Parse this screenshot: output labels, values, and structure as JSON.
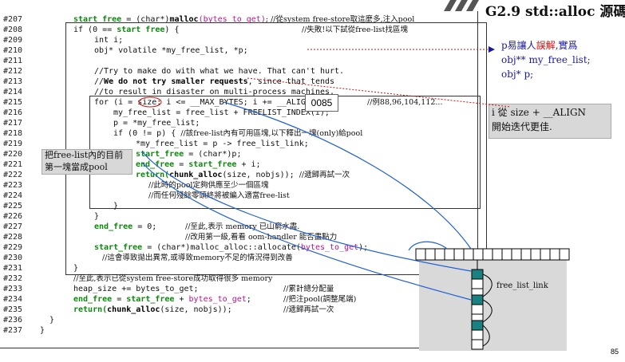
{
  "title": "G2.9 std::alloc 源碼剖",
  "tooltip_value": "0085",
  "page_number": "85",
  "line_numbers": [
    "#207",
    "#208",
    "#209",
    "#210",
    "#211",
    "#212",
    "#213",
    "#214",
    "#215",
    "#216",
    "#217",
    "#218",
    "#219",
    "#220",
    "#221",
    "#222",
    "#223",
    "#224",
    "#225",
    "#226",
    "#227",
    "#228",
    "#229",
    "#230",
    "#231",
    "#232",
    "#233",
    "#234",
    "#235",
    "#236",
    "#237"
  ],
  "code": {
    "l207_a": "start free",
    "l207_b": " = (char*)",
    "l207_c": "malloc",
    "l207_d": "(bytes to get)",
    "l207_e": "; //從system free-store取這麼多,注入pool",
    "l208_a": "if (0 == ",
    "l208_b": "start free",
    "l208_c": ") {",
    "l208_d": "//失敗!以下試從free-list找區塊",
    "l209": "int i;",
    "l210": "obj* volatile *my_free_list, *p;",
    "l212": "//Try to make do with what we have. That can't hurt.",
    "l213_a": "//",
    "l213_b": "We do not try smaller requests",
    "l213_c": ", since that tends",
    "l214": "//to result in disaster on multi-process machines.",
    "l215": "for (i = size; i <= __MAX_BYTES; i += __ALIGN) {",
    "l215_c": "//例88,96,104,112...",
    "l216": "my_free_list = free_list + FREELIST_INDEX(i);",
    "l217": "p = *my_free_list;",
    "l218_a": "if (0 != p) {",
    "l218_b": "//該free-list內有可用區塊,以下釋出一塊(only)給pool",
    "l219": "*my_free_list = p -> free_list_link;",
    "l220_a": "start_free",
    "l220_b": " = (char*)p;",
    "l221_a": "end_free",
    "l221_b": " = ",
    "l221_c": "start_free",
    "l221_d": " + i;",
    "l222_a": "return(",
    "l222_b": "chunk_alloc",
    "l222_c": "(size, nobjs));",
    "l222_d": "//遞歸再試一次",
    "l223": "//此時的pool定夠供應至少一個區塊",
    "l224": "//而任何殘餘零頭終將被編入適當free-list",
    "l225": "}",
    "l226": "}",
    "l227_a": "end_free",
    "l227_b": " = 0;",
    "l227_c": "//至此,表示 memory 已山窮水盡.",
    "l228": "//改用第一級,看看 oom-handler 能否盡點力",
    "l229_a": "start_free",
    "l229_b": " = (char*)malloc_alloc::allocate(",
    "l229_c": "bytes_to_get",
    "l229_d": ");",
    "l230": "//這會導致拋出異常,或導致memory不足的情況得到改善",
    "l231": "}",
    "l232": "//至此,表示已從system free-store成功取得很多 memory",
    "l233_a": "heap_size += bytes_to_get;",
    "l233_b": "//累計總分配量",
    "l234_a": "end_free",
    "l234_b": " = ",
    "l234_c": "start_free",
    "l234_d": " + ",
    "l234_e": "bytes_to_get",
    "l234_f": ";",
    "l234_g": "//把注pool(調整尾端)",
    "l235_a": "return(",
    "l235_b": "chunk_alloc",
    "l235_c": "(size, nobjs));",
    "l235_d": "//遞歸再試一次",
    "l236": "}",
    "l237": "}"
  },
  "notes": {
    "p_note_a": "p易讓人",
    "p_note_red": "誤解",
    "p_note_b": ",實爲",
    "p_note_2": "obj** my_free_list;",
    "p_note_3": "obj* p;",
    "align_note_1": "i 從 size + __ALIGN",
    "align_note_2": "開始迭代更佳.",
    "left_note_1": "把free-list內的目前",
    "left_note_2": "第一塊當成pool",
    "free_list_link": "free_list_link"
  },
  "colors": {
    "green": "#0a8a0a",
    "magenta": "#c0108a",
    "blue_text": "#1a1aa0",
    "red": "#d01010",
    "arrow_blue": "#1f5fd8",
    "teal": "#1a8080"
  }
}
